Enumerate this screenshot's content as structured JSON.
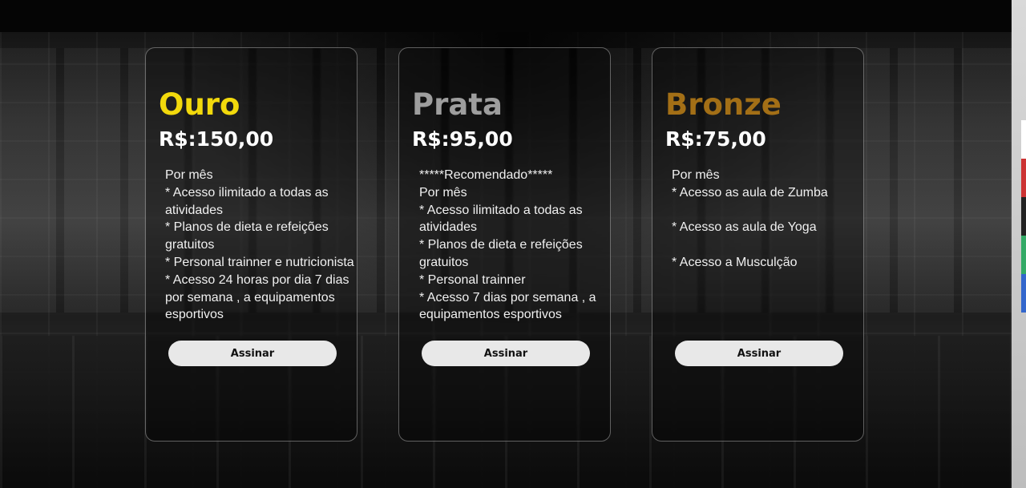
{
  "plans": [
    {
      "name": "Ouro",
      "price": "R$:150,00",
      "features": [
        "Por mês",
        "* Acesso ilimitado a todas as atividades",
        "* Planos de dieta e refeições gratuitos",
        "* Personal trainner e nutricionista",
        "* Acesso 24 horas por dia 7 dias por semana , a equipamentos esportivos"
      ],
      "button_label": "Assinar",
      "color": "#f2d90c"
    },
    {
      "name": "Prata",
      "price": "R$:95,00",
      "features": [
        "*****Recomendado*****",
        "Por mês",
        "* Acesso ilimitado a todas as atividades",
        "* Planos de dieta e refeições gratuitos",
        "* Personal trainner",
        "* Acesso 7 dias por semana , a equipamentos esportivos"
      ],
      "button_label": "Assinar",
      "color": "#9e9e9e"
    },
    {
      "name": "Bronze",
      "price": "R$:75,00",
      "features": [
        "Por mês",
        "* Acesso as aula de Zumba",
        "",
        "* Acesso as aula de Yoga",
        "",
        "* Acesso a Musculção"
      ],
      "button_label": "Assinar",
      "color": "#a36f16"
    }
  ]
}
